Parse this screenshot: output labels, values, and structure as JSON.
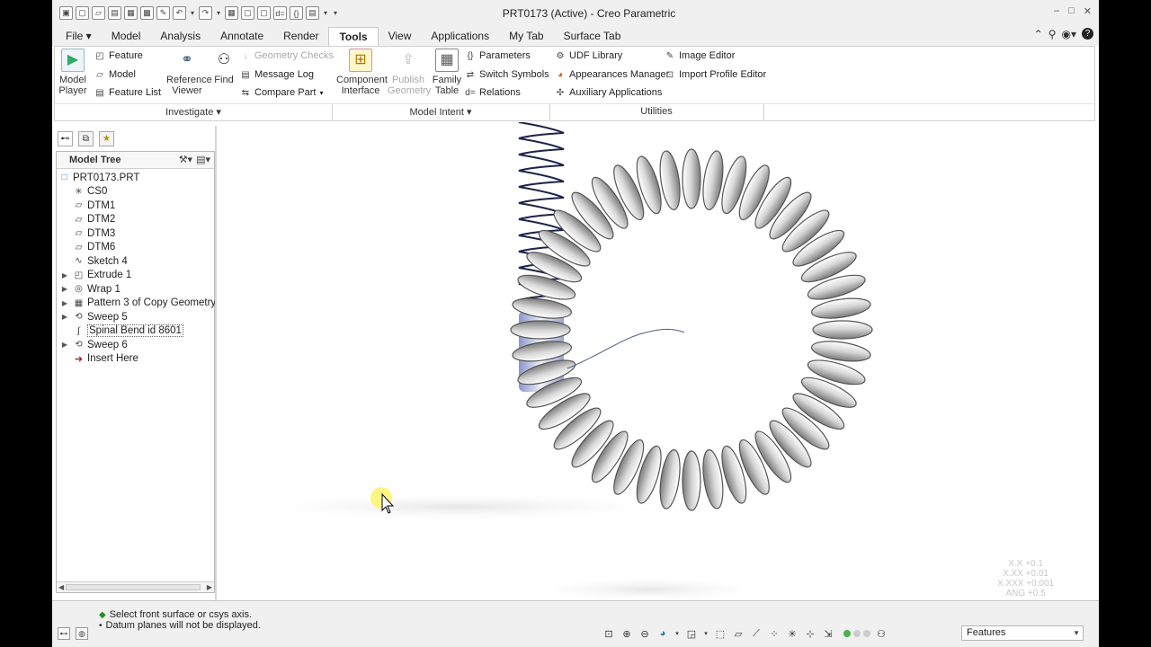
{
  "window": {
    "title": "PRT0173 (Active) - Creo Parametric",
    "controls": [
      "–",
      "□",
      "✕"
    ]
  },
  "quick_access": [
    "▣",
    "▢",
    "▱",
    "▤",
    "▦",
    "▩",
    "✎",
    "↶",
    "↷",
    "▦",
    "▢",
    "▢",
    "d=",
    "{}",
    "▤"
  ],
  "tabs": [
    {
      "label": "File ▾"
    },
    {
      "label": "Model"
    },
    {
      "label": "Analysis"
    },
    {
      "label": "Annotate"
    },
    {
      "label": "Render"
    },
    {
      "label": "Tools",
      "active": true
    },
    {
      "label": "View"
    },
    {
      "label": "Applications"
    },
    {
      "label": "My Tab"
    },
    {
      "label": "Surface Tab"
    }
  ],
  "ribbon": {
    "investigate": {
      "model_player": "Model Player",
      "feature": "Feature",
      "model": "Model",
      "feature_list": "Feature List",
      "reference_viewer": "Reference Viewer",
      "find": "Find",
      "geometry_checks": "Geometry Checks",
      "message_log": "Message Log",
      "compare_part": "Compare Part",
      "label": "Investigate ▾"
    },
    "model_intent": {
      "component_interface": "Component Interface",
      "publish_geometry": "Publish Geometry",
      "family_table": "Family Table",
      "parameters": "Parameters",
      "switch_symbols": "Switch Symbols",
      "relations": "Relations",
      "label": "Model Intent ▾"
    },
    "utilities": {
      "udf_library": "UDF Library",
      "appearances_manager": "Appearances Manager",
      "auxiliary_applications": "Auxiliary Applications",
      "image_editor": "Image Editor",
      "import_profile_editor": "Import Profile Editor",
      "label": "Utilities"
    }
  },
  "model_tree": {
    "title": "Model Tree",
    "items": [
      {
        "label": "PRT0173.PRT",
        "icon": "□",
        "expand": ""
      },
      {
        "label": "CS0",
        "icon": "✳",
        "expand": ""
      },
      {
        "label": "DTM1",
        "icon": "▱",
        "expand": ""
      },
      {
        "label": "DTM2",
        "icon": "▱",
        "expand": ""
      },
      {
        "label": "DTM3",
        "icon": "▱",
        "expand": ""
      },
      {
        "label": "DTM6",
        "icon": "▱",
        "expand": ""
      },
      {
        "label": "Sketch 4",
        "icon": "∿",
        "expand": ""
      },
      {
        "label": "Extrude 1",
        "icon": "◰",
        "expand": "▶"
      },
      {
        "label": "Wrap 1",
        "icon": "◎",
        "expand": "▶"
      },
      {
        "label": "Pattern 3 of Copy Geometry",
        "icon": "▦",
        "expand": "▶"
      },
      {
        "label": "Sweep 5",
        "icon": "⟲",
        "expand": "▶"
      },
      {
        "label": "Spinal Bend id 8601",
        "icon": "∫",
        "expand": ""
      },
      {
        "label": "Sweep 6",
        "icon": "⟲",
        "expand": "▶"
      },
      {
        "label": "Insert Here",
        "icon": "➜",
        "expand": ""
      }
    ]
  },
  "tolerance": [
    "X.X +0.1",
    "X.XX +0.01",
    "X.XXX +0.001",
    "ANG +0.5"
  ],
  "status": {
    "messages": [
      "Select front surface or csys axis.",
      "Datum planes will not be displayed."
    ],
    "filter": "Features"
  }
}
